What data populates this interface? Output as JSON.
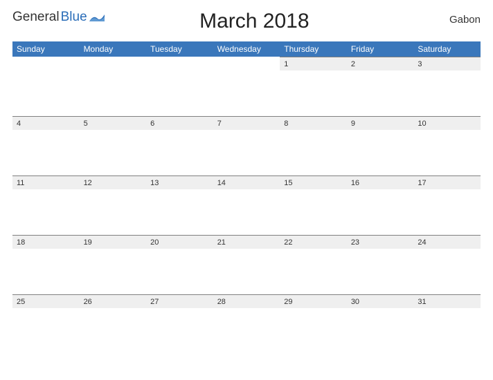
{
  "brand": {
    "part1": "General",
    "part2": "Blue"
  },
  "title": "March 2018",
  "country": "Gabon",
  "weekdays": [
    "Sunday",
    "Monday",
    "Tuesday",
    "Wednesday",
    "Thursday",
    "Friday",
    "Saturday"
  ],
  "weeks": [
    [
      "",
      "",
      "",
      "",
      "1",
      "2",
      "3"
    ],
    [
      "4",
      "5",
      "6",
      "7",
      "8",
      "9",
      "10"
    ],
    [
      "11",
      "12",
      "13",
      "14",
      "15",
      "16",
      "17"
    ],
    [
      "18",
      "19",
      "20",
      "21",
      "22",
      "23",
      "24"
    ],
    [
      "25",
      "26",
      "27",
      "28",
      "29",
      "30",
      "31"
    ]
  ]
}
